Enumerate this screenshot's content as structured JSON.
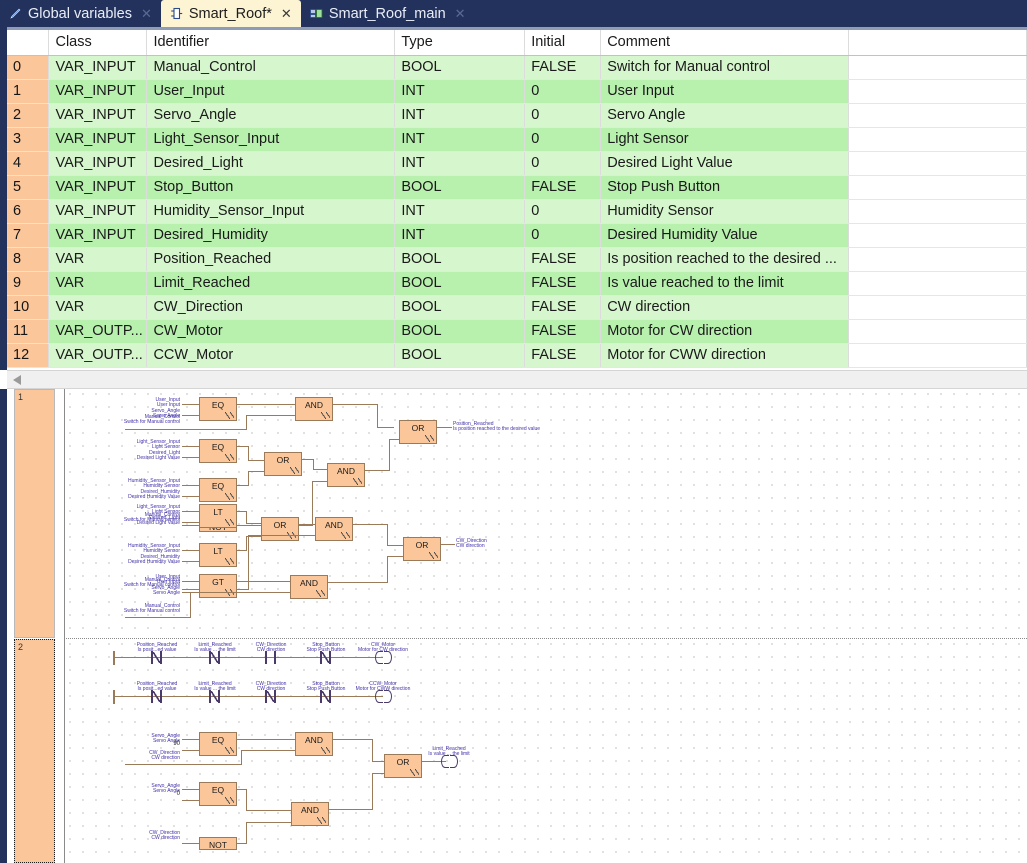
{
  "tabs": [
    {
      "label": "Global variables",
      "icon": "pencil-icon",
      "active": false,
      "closable": true
    },
    {
      "label": "Smart_Roof*",
      "icon": "function-block-icon",
      "active": true,
      "closable": true
    },
    {
      "label": "Smart_Roof_main",
      "icon": "program-icon",
      "active": false,
      "closable": true
    }
  ],
  "variable_table": {
    "columns": [
      "",
      "Class",
      "Identifier",
      "Type",
      "Initial",
      "Comment",
      ""
    ],
    "selected_cell": {
      "row": 12,
      "column": "Class"
    },
    "rows": [
      {
        "index": "0",
        "class": "VAR_INPUT",
        "identifier": "Manual_Control",
        "type": "BOOL",
        "initial": "FALSE",
        "comment": "Switch for Manual control"
      },
      {
        "index": "1",
        "class": "VAR_INPUT",
        "identifier": "User_Input",
        "type": "INT",
        "initial": "0",
        "comment": "User Input"
      },
      {
        "index": "2",
        "class": "VAR_INPUT",
        "identifier": "Servo_Angle",
        "type": "INT",
        "initial": "0",
        "comment": "Servo Angle"
      },
      {
        "index": "3",
        "class": "VAR_INPUT",
        "identifier": "Light_Sensor_Input",
        "type": "INT",
        "initial": "0",
        "comment": "Light Sensor"
      },
      {
        "index": "4",
        "class": "VAR_INPUT",
        "identifier": "Desired_Light",
        "type": "INT",
        "initial": "0",
        "comment": "Desired Light Value"
      },
      {
        "index": "5",
        "class": "VAR_INPUT",
        "identifier": "Stop_Button",
        "type": "BOOL",
        "initial": "FALSE",
        "comment": "Stop Push Button"
      },
      {
        "index": "6",
        "class": "VAR_INPUT",
        "identifier": "Humidity_Sensor_Input",
        "type": "INT",
        "initial": "0",
        "comment": "Humidity Sensor"
      },
      {
        "index": "7",
        "class": "VAR_INPUT",
        "identifier": "Desired_Humidity",
        "type": "INT",
        "initial": "0",
        "comment": "Desired Humidity Value"
      },
      {
        "index": "8",
        "class": "VAR",
        "identifier": "Position_Reached",
        "type": "BOOL",
        "initial": "FALSE",
        "comment": "Is position reached to the desired ..."
      },
      {
        "index": "9",
        "class": "VAR",
        "identifier": "Limit_Reached",
        "type": "BOOL",
        "initial": "FALSE",
        "comment": "Is value reached to the limit"
      },
      {
        "index": "10",
        "class": "VAR",
        "identifier": "CW_Direction",
        "type": "BOOL",
        "initial": "FALSE",
        "comment": "CW direction"
      },
      {
        "index": "11",
        "class": "VAR_OUTP...",
        "identifier": "CW_Motor",
        "type": "BOOL",
        "initial": "FALSE",
        "comment": "Motor for CW direction"
      },
      {
        "index": "12",
        "class": "VAR_OUTP...",
        "identifier": "CCW_Motor",
        "type": "BOOL",
        "initial": "FALSE",
        "comment": "Motor for CWW direction"
      }
    ]
  },
  "editor": {
    "networks": [
      {
        "label": "1",
        "selected": false
      },
      {
        "label": "2",
        "selected": true
      }
    ],
    "net1": {
      "group_a": {
        "eq1": {
          "op": "EQ",
          "in1": "User_Input",
          "in1c": "User Input",
          "in2": "Servo_Angle",
          "in2c": "Servo Angle"
        },
        "and1": {
          "op": "AND",
          "in2": "Manual_Control",
          "in2c": "Switch for Manual control"
        },
        "eq2": {
          "op": "EQ",
          "in1": "Light_Sensor_Input",
          "in1c": "Light Sensor",
          "in2": "Desired_Light",
          "in2c": "Desired Light Value"
        },
        "eq3": {
          "op": "EQ",
          "in1": "Humidity_Sensor_Input",
          "in1c": "Humidity Sensor",
          "in2": "Desired_Humidity",
          "in2c": "Desired Humidity Value"
        },
        "or1": {
          "op": "OR"
        },
        "not1": {
          "op": "NOT",
          "in1": "Manual_Control",
          "in1c": "Switch for Manual control"
        },
        "and2": {
          "op": "AND"
        },
        "or_out": {
          "op": "OR",
          "out": "Position_Reached",
          "outc": "Is position reached to the desired value"
        }
      },
      "group_b": {
        "lt1": {
          "op": "LT",
          "in1": "Light_Sensor_Input",
          "in1c": "Light Sensor",
          "in2": "Desired_Light",
          "in2c": "Desired Light Value"
        },
        "lt2": {
          "op": "LT",
          "in1": "Humidity_Sensor_Input",
          "in1c": "Humidity Sensor",
          "in2": "Desired_Humidity",
          "in2c": "Desired Humidity Value"
        },
        "or1": {
          "op": "OR"
        },
        "not1": {
          "op": "NOT",
          "in1": "Manual_Control",
          "in1c": "Switch for Manual control"
        },
        "and1": {
          "op": "AND"
        },
        "gt1": {
          "op": "GT",
          "in1": "User_Input",
          "in1c": "User Input",
          "in2": "Servo_Angle",
          "in2c": "Servo Angle"
        },
        "and2": {
          "op": "AND",
          "in2": "Manual_Control",
          "in2c": "Switch for Manual control"
        },
        "or_out": {
          "op": "OR",
          "out": "CW_Direction",
          "outc": "CW direction"
        }
      }
    },
    "net2": {
      "rung1": {
        "contacts": [
          {
            "name": "Position_Reached",
            "comment": "Is posit...ed value",
            "negated": true
          },
          {
            "name": "Limit_Reached",
            "comment": "Is value ... the limit",
            "negated": true
          },
          {
            "name": "CW_Direction",
            "comment": "CW direction",
            "negated": false
          },
          {
            "name": "Stop_Button",
            "comment": "Stop Push Button",
            "negated": true
          }
        ],
        "coil": {
          "name": "CW_Motor",
          "comment": "Motor for CW direction"
        }
      },
      "rung2": {
        "contacts": [
          {
            "name": "Position_Reached",
            "comment": "Is posit...ed value",
            "negated": true
          },
          {
            "name": "Limit_Reached",
            "comment": "Is value ... the limit",
            "negated": true
          },
          {
            "name": "CW_Direction",
            "comment": "CW direction",
            "negated": true
          },
          {
            "name": "Stop_Button",
            "comment": "Stop Push Button",
            "negated": true
          }
        ],
        "coil": {
          "name": "CCW_Motor",
          "comment": "Motor for CWW direction"
        }
      },
      "fbd": {
        "eq1": {
          "op": "EQ",
          "in1": "Servo_Angle",
          "in1c": "Servo Angle",
          "in2": "90"
        },
        "and1": {
          "op": "AND",
          "in2": "CW_Direction",
          "in2c": "CW direction"
        },
        "eq2": {
          "op": "EQ",
          "in1": "Servo_Angle",
          "in1c": "Servo Angle",
          "in2": "0"
        },
        "not1": {
          "op": "NOT",
          "in1": "CW_Direction",
          "in1c": "CW direction"
        },
        "and2": {
          "op": "AND"
        },
        "or1": {
          "op": "OR"
        },
        "coil": {
          "name": "Limit_Reached",
          "comment": "Is value ... the limit"
        }
      }
    }
  },
  "colors": {
    "titlebar": "#23325c",
    "active_tab": "#fdf4d4",
    "row_index": "#fac69a",
    "row_band_a": "#d6f7cd",
    "row_band_b": "#b8f0ae",
    "block_fill": "#fac69a",
    "wire": "#9a7a58",
    "label_text": "#4030a8"
  }
}
